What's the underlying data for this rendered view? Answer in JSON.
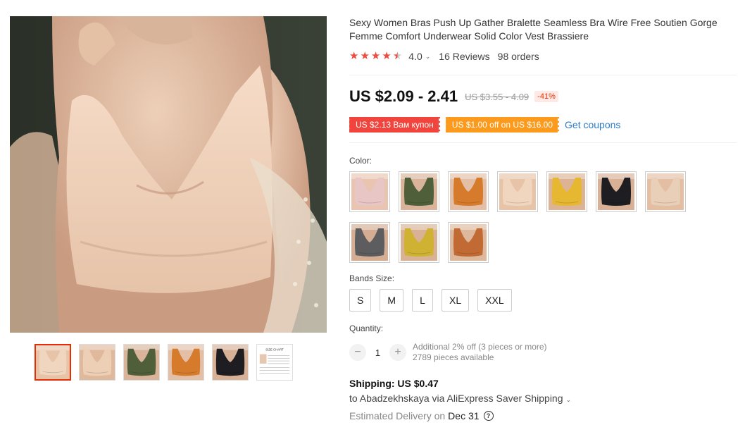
{
  "product": {
    "title": "Sexy Women Bras Push Up Gather Bralette Seamless Bra Wire Free Soutien Gorge Femme Comfort Underwear Solid Color Vest Brassiere",
    "rating": 4.0,
    "rating_label": "4.0",
    "reviews": "16 Reviews",
    "orders": "98 orders"
  },
  "price": {
    "current": "US $2.09 - 2.41",
    "original": "US $3.55 - 4.09",
    "discount": "-41%"
  },
  "coupons": {
    "coupon1": "US $2.13 Вам купон",
    "coupon2": "US $1.00 off on US $16.00",
    "get_coupons": "Get coupons"
  },
  "colors": {
    "label": "Color:",
    "swatches": [
      {
        "name": "pink",
        "color": "#e8c6c6",
        "skin": "#e9c4b0"
      },
      {
        "name": "green",
        "color": "#4f5f3a",
        "skin": "#d9b49a"
      },
      {
        "name": "orange",
        "color": "#d67a2b",
        "skin": "#e2bfa6"
      },
      {
        "name": "nude",
        "color": "#f0d6bf",
        "skin": "#e7c3a7"
      },
      {
        "name": "yellow",
        "color": "#e6b832",
        "skin": "#dcb394"
      },
      {
        "name": "black",
        "color": "#1e1e22",
        "skin": "#d8b095"
      },
      {
        "name": "beige",
        "color": "#e9cfb8",
        "skin": "#e4bea3"
      },
      {
        "name": "gray",
        "color": "#5d5d5f",
        "skin": "#d5ad92"
      },
      {
        "name": "mustard",
        "color": "#cfb232",
        "skin": "#d9b296"
      },
      {
        "name": "caramel",
        "color": "#c26a33",
        "skin": "#deb89c"
      }
    ]
  },
  "sizes": {
    "label": "Bands Size:",
    "options": [
      "S",
      "M",
      "L",
      "XL",
      "XXL"
    ]
  },
  "quantity": {
    "label": "Quantity:",
    "value": "1",
    "minus": "−",
    "plus": "+",
    "info_line1": "Additional 2% off (3 pieces or more)",
    "info_line2": "2789 pieces available"
  },
  "shipping": {
    "title": "Shipping: US $0.47",
    "to": "to Abadzekhskaya via AliExpress Saver Shipping",
    "delivery_label": "Estimated Delivery on",
    "delivery_date": "Dec 31"
  },
  "icons": {
    "chevron_down": "⌄",
    "help": "?"
  },
  "thumbnails": [
    {
      "name": "nude",
      "color": "#f0d6bf",
      "skin": "#e7c3a7"
    },
    {
      "name": "nude-back",
      "color": "#eccfb4",
      "skin": "#e0b99d"
    },
    {
      "name": "green",
      "color": "#4f5f3a",
      "skin": "#d9b49a"
    },
    {
      "name": "orange",
      "color": "#d67a2b",
      "skin": "#e2bfa6"
    },
    {
      "name": "black",
      "color": "#1e1e22",
      "skin": "#d8b095"
    },
    {
      "name": "size-chart",
      "text": "SIZE CHART"
    }
  ],
  "theme": {
    "accent": "#e62e04",
    "star": "#f04a3c",
    "link": "#2e7bc4",
    "coupon_red": "#f0443d",
    "coupon_orange": "#fb9a1d"
  }
}
